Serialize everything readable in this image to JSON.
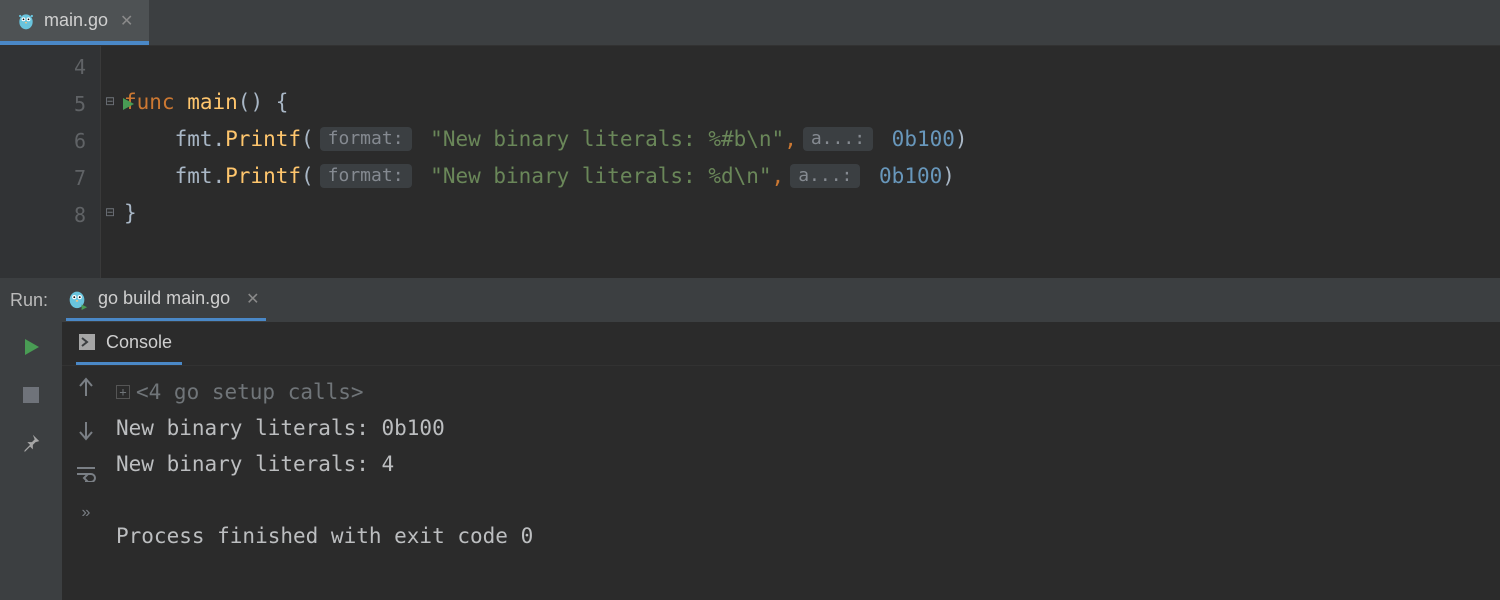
{
  "editor": {
    "tab": {
      "filename": "main.go"
    },
    "gutter_start": 4,
    "lines": [
      {
        "n": 4,
        "segs": []
      },
      {
        "n": 5,
        "run_marker": true,
        "fold": "open-top",
        "segs": [
          {
            "t": "func ",
            "c": "kw"
          },
          {
            "t": "main",
            "c": "ident"
          },
          {
            "t": "() {",
            "c": "plain"
          }
        ]
      },
      {
        "n": 6,
        "segs": [
          {
            "t": "    fmt.",
            "c": "plain"
          },
          {
            "t": "Printf",
            "c": "ident"
          },
          {
            "t": "(",
            "c": "plain"
          },
          {
            "hint": "format:"
          },
          {
            "t": " \"New binary literals: %#b\\n\"",
            "c": "str"
          },
          {
            "t": ",",
            "c": "comma"
          },
          {
            "hint": "a...:"
          },
          {
            "t": " 0b100",
            "c": "num"
          },
          {
            "t": ")",
            "c": "plain"
          }
        ]
      },
      {
        "n": 7,
        "segs": [
          {
            "t": "    fmt.",
            "c": "plain"
          },
          {
            "t": "Printf",
            "c": "ident"
          },
          {
            "t": "(",
            "c": "plain"
          },
          {
            "hint": "format:"
          },
          {
            "t": " \"New binary literals: %d\\n\"",
            "c": "str"
          },
          {
            "t": ",",
            "c": "comma"
          },
          {
            "hint": "a...:"
          },
          {
            "t": " 0b100",
            "c": "num"
          },
          {
            "t": ")",
            "c": "plain"
          }
        ]
      },
      {
        "n": 8,
        "fold": "open-bottom",
        "segs": [
          {
            "t": "}",
            "c": "plain"
          }
        ]
      }
    ]
  },
  "run": {
    "panel_label": "Run:",
    "config_name": "go build main.go",
    "console_tab": "Console",
    "output": {
      "folded_header": "<4 go setup calls>",
      "lines": [
        "New binary literals: 0b100",
        "New binary literals: 4",
        "",
        "Process finished with exit code 0"
      ]
    }
  }
}
